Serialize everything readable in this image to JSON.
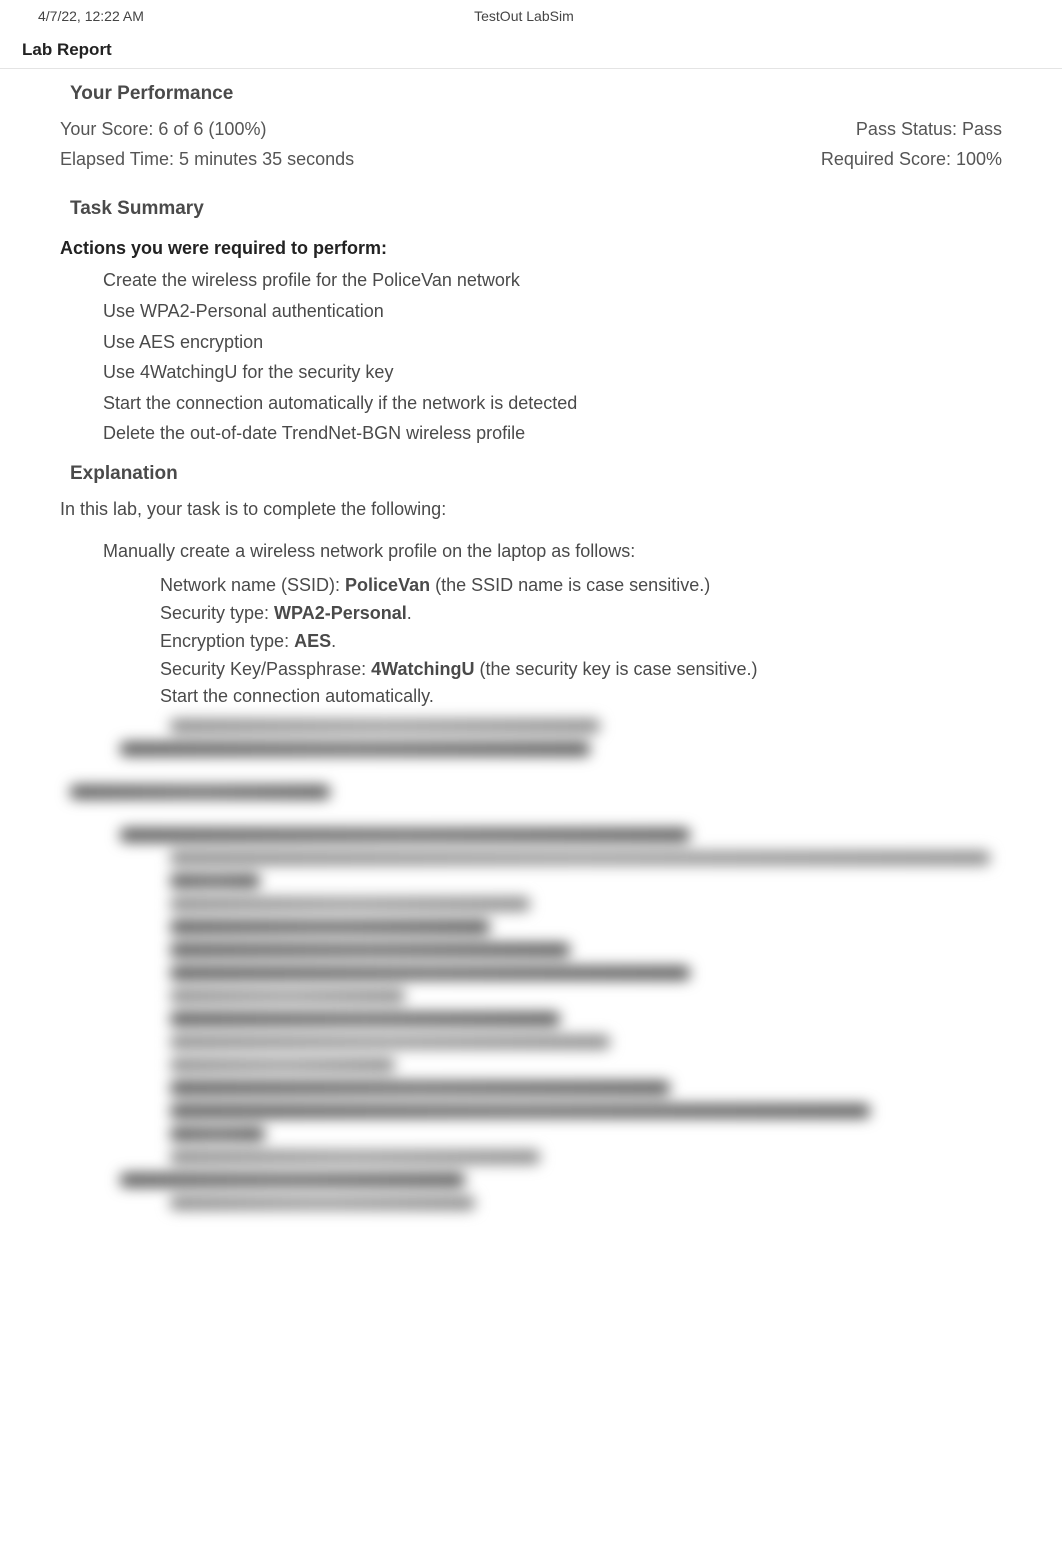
{
  "header": {
    "timestamp": "4/7/22, 12:22 AM",
    "center_title": "TestOut LabSim"
  },
  "report_title": "Lab Report",
  "performance": {
    "heading": "Your Performance",
    "score_label": "Your Score: 6 of 6 (100%)",
    "elapsed_label": "Elapsed Time: 5 minutes 35 seconds",
    "pass_status_label": "Pass Status: Pass",
    "required_score_label": "Required Score: 100%"
  },
  "task_summary": {
    "heading": "Task Summary",
    "actions_heading": "Actions you were required to perform:",
    "actions": [
      "Create the wireless profile for the PoliceVan network",
      "Use WPA2-Personal authentication",
      "Use AES encryption",
      "Use 4WatchingU for the security key",
      "Start the connection automatically if the network is detected",
      "Delete the out-of-date TrendNet-BGN wireless profile"
    ]
  },
  "explanation": {
    "heading": "Explanation",
    "lead": "In this lab, your task is to complete the following:",
    "main_item": "Manually create a wireless network profile on the laptop as follows:",
    "sub_items": [
      {
        "pre": "Network name (SSID): ",
        "bold": "PoliceVan",
        "post": " (the SSID name is case sensitive.)"
      },
      {
        "pre": "Security type: ",
        "bold": "WPA2-Personal",
        "post": "."
      },
      {
        "pre": "Encryption type: ",
        "bold": "AES",
        "post": "."
      },
      {
        "pre": "Security Key/Passphrase: ",
        "bold": "4WatchingU",
        "post": " (the security key is case sensitive.)"
      },
      {
        "pre": "Start the connection automatically.",
        "bold": "",
        "post": ""
      }
    ]
  }
}
